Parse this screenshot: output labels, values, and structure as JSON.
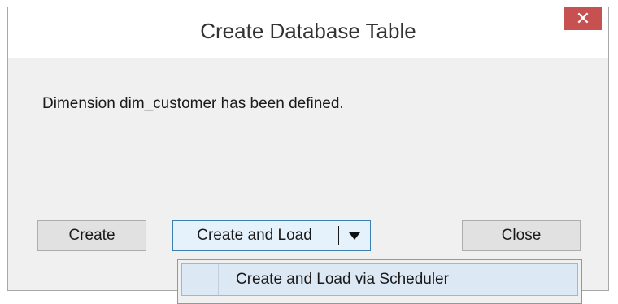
{
  "dialog": {
    "title": "Create Database Table",
    "close_icon": "✕",
    "message": "Dimension dim_customer has been defined."
  },
  "buttons": {
    "create": "Create",
    "create_and_load": "Create and Load",
    "close": "Close"
  },
  "dropdown_menu": {
    "items": [
      {
        "label": "Create and Load via Scheduler",
        "highlighted": true
      }
    ]
  },
  "colors": {
    "close_button_bg": "#c75050",
    "split_button_bg": "#e5f1fb",
    "split_button_border": "#3c7fb1",
    "menu_highlight_bg": "#dde8f5"
  }
}
